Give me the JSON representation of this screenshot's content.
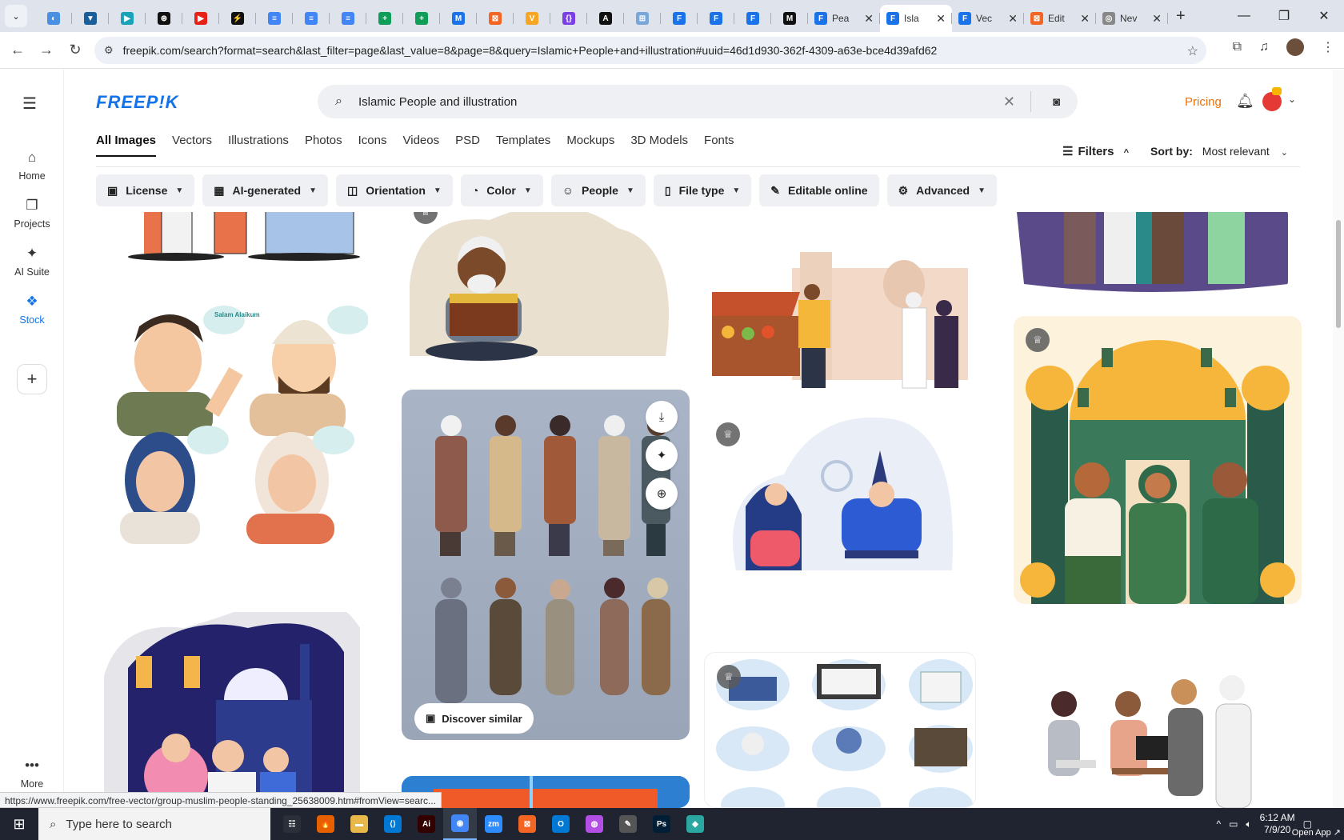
{
  "browser": {
    "tabs": [
      {
        "icon_color": "#4a90e2",
        "glyph": "◐"
      },
      {
        "icon_color": "#1a5e9a",
        "glyph": "▼"
      },
      {
        "icon_color": "#1aa2b8",
        "glyph": "▶"
      },
      {
        "icon_color": "#111111",
        "glyph": "⊛"
      },
      {
        "icon_color": "#e62117",
        "glyph": "▶"
      },
      {
        "icon_color": "#111111",
        "glyph": "⚡"
      },
      {
        "icon_color": "#4285f4",
        "glyph": "≡"
      },
      {
        "icon_color": "#4285f4",
        "glyph": "≡"
      },
      {
        "icon_color": "#4285f4",
        "glyph": "≡"
      },
      {
        "icon_color": "#0f9d58",
        "glyph": "+"
      },
      {
        "icon_color": "#0f9d58",
        "glyph": "+"
      },
      {
        "icon_color": "#1a73e8",
        "glyph": "M"
      },
      {
        "icon_color": "#f26522",
        "glyph": "⊠"
      },
      {
        "icon_color": "#f5a623",
        "glyph": "V"
      },
      {
        "icon_color": "#7b3fe4",
        "glyph": "{}"
      },
      {
        "icon_color": "#111111",
        "glyph": "A"
      },
      {
        "icon_color": "#7aa7d9",
        "glyph": "⊞"
      },
      {
        "icon_color": "#1a73e8",
        "glyph": "F"
      },
      {
        "icon_color": "#1a73e8",
        "glyph": "F"
      },
      {
        "icon_color": "#1a73e8",
        "glyph": "F"
      },
      {
        "icon_color": "#111111",
        "glyph": "M"
      }
    ],
    "wide_tabs": [
      {
        "title": "Pea",
        "icon_color": "#1a73e8",
        "glyph": "F",
        "active": false
      },
      {
        "title": "Isla",
        "icon_color": "#1a73e8",
        "glyph": "F",
        "active": true
      },
      {
        "title": "Vec",
        "icon_color": "#1a73e8",
        "glyph": "F",
        "active": false
      },
      {
        "title": "Edit",
        "icon_color": "#f26522",
        "glyph": "⊠",
        "active": false
      },
      {
        "title": "Nev",
        "icon_color": "#888888",
        "glyph": "◎",
        "active": false
      }
    ],
    "url": "freepik.com/search?format=search&last_filter=page&last_value=8&page=8&query=Islamic+People+and+illustration#uuid=46d1d930-362f-4309-a63e-bce4d39afd62",
    "status_url": "https://www.freepik.com/free-vector/group-muslim-people-standing_25638009.htm#fromView=searc..."
  },
  "site": {
    "logo": "FREEP!K",
    "search_value": "Islamic People and illustration",
    "pricing": "Pricing",
    "sidebar": [
      {
        "label": "Home",
        "icon": "⌂",
        "active": false
      },
      {
        "label": "Projects",
        "icon": "❐",
        "active": false
      },
      {
        "label": "AI Suite",
        "icon": "✦",
        "active": false
      },
      {
        "label": "Stock",
        "icon": "❖",
        "active": true
      }
    ],
    "more": "More",
    "categories": [
      "All Images",
      "Vectors",
      "Illustrations",
      "Photos",
      "Icons",
      "Videos",
      "PSD",
      "Templates",
      "Mockups",
      "3D Models",
      "Fonts"
    ],
    "filters_label": "Filters",
    "sort_label": "Sort by:",
    "sort_value": "Most relevant",
    "chips": [
      {
        "label": "License",
        "icon": "▣"
      },
      {
        "label": "AI-generated",
        "icon": "▦"
      },
      {
        "label": "Orientation",
        "icon": "◫"
      },
      {
        "label": "Color",
        "icon": "◔"
      },
      {
        "label": "People",
        "icon": "☺"
      },
      {
        "label": "File type",
        "icon": "▯"
      },
      {
        "label": "Editable online",
        "icon": "✎"
      },
      {
        "label": "Advanced",
        "icon": "⚙"
      }
    ],
    "discover_similar": "Discover similar",
    "speech_bubble": "Salam Alaikum"
  },
  "taskbar": {
    "search_placeholder": "Type here to search",
    "time": "6:12 AM",
    "date": "7/9/20",
    "open_app": "Open App ↗",
    "apps": [
      {
        "glyph": "☷",
        "color": "#2b2f3a"
      },
      {
        "glyph": "🔥",
        "color": "#e66000"
      },
      {
        "glyph": "▬",
        "color": "#e8b84a"
      },
      {
        "glyph": "⟨⟩",
        "color": "#0078d4"
      },
      {
        "glyph": "Ai",
        "color": "#330000"
      },
      {
        "glyph": "◉",
        "color": "#4285f4"
      },
      {
        "glyph": "zm",
        "color": "#2d8cff"
      },
      {
        "glyph": "⊠",
        "color": "#f26522"
      },
      {
        "glyph": "O",
        "color": "#0078d4"
      },
      {
        "glyph": "◍",
        "color": "#b44fe6"
      },
      {
        "glyph": "✎",
        "color": "#555555"
      },
      {
        "glyph": "Ps",
        "color": "#001e36"
      },
      {
        "glyph": "◆",
        "color": "#2aa7a0"
      }
    ]
  }
}
